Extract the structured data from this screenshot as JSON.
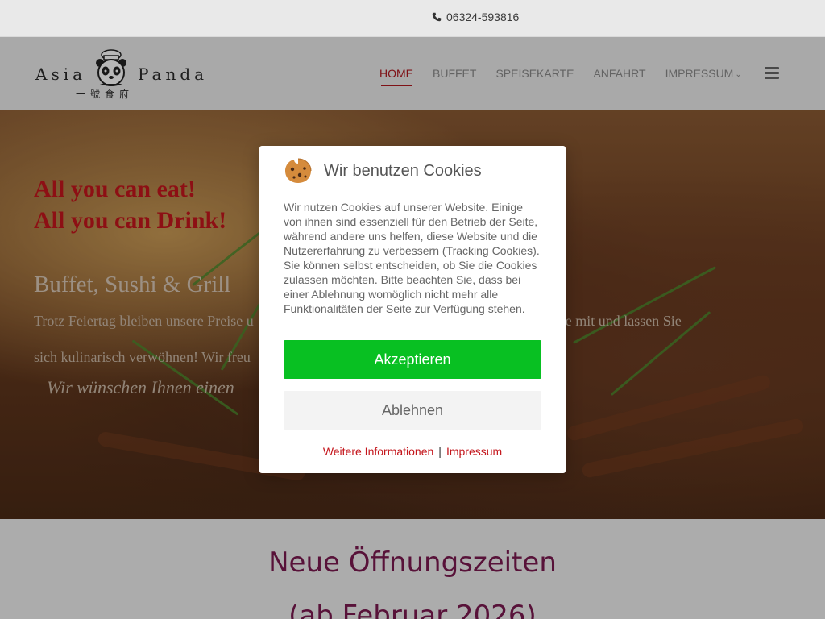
{
  "topbar": {
    "phone": "06324-593816",
    "phone_icon": "phone-icon"
  },
  "logo": {
    "word_left": "Asia",
    "word_right": "Panda",
    "chinese": "一號食府",
    "icon": "panda-icon"
  },
  "nav": {
    "items": [
      {
        "label": "HOME",
        "active": true
      },
      {
        "label": "BUFFET",
        "active": false
      },
      {
        "label": "SPEISEKARTE",
        "active": false
      },
      {
        "label": "ANFAHRT",
        "active": false
      },
      {
        "label": "IMPRESSUM",
        "active": false,
        "dropdown": true
      }
    ],
    "menu_icon": "hamburger-icon"
  },
  "hero": {
    "line1": "All you can eat!",
    "line2": "All you can Drink!",
    "subtitle": "Buffet, Sushi & Grill",
    "para_line1_start": "Trotz Feiertag bleiben unsere Preise u",
    "para_line1_end": "ilie & Freunde mit und lassen Sie",
    "para_line2": "sich kulinarisch verwöhnen!  Wir freu",
    "italic": "Wir wünschen Ihnen einen"
  },
  "section": {
    "heading1": "Neue Öffnungszeiten",
    "heading2": "(ab Februar 2026)"
  },
  "cookie": {
    "icon": "cookie-icon",
    "title": "Wir benutzen Cookies",
    "text": "Wir nutzen Cookies auf unserer Website. Einige von ihnen sind essenziell für den Betrieb der Seite, während andere uns helfen, diese Website und die Nutzererfahrung zu verbessern (Tracking Cookies). Sie können selbst entscheiden, ob Sie die Cookies zulassen möchten. Bitte beachten Sie, dass bei einer Ablehnung womöglich nicht mehr alle Funktionalitäten der Seite zur Verfügung stehen.",
    "accept": "Akzeptieren",
    "decline": "Ablehnen",
    "link_info": "Weitere Informationen",
    "link_sep": "|",
    "link_impressum": "Impressum"
  },
  "colors": {
    "accent_red": "#c4161c",
    "accept_green": "#08c022",
    "heading_magenta": "#7a1a50"
  }
}
